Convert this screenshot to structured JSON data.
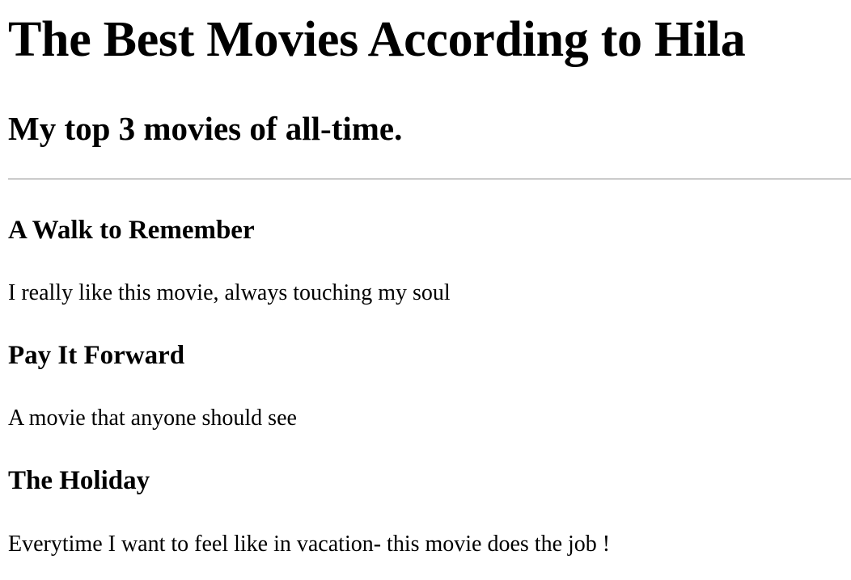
{
  "header": {
    "title": "The Best Movies According to Hila",
    "subtitle": "My top 3 movies of all-time."
  },
  "movies": [
    {
      "title": "A Walk to Remember",
      "description": "I really like this movie, always touching my soul"
    },
    {
      "title": "Pay It Forward",
      "description": "A movie that anyone should see"
    },
    {
      "title": "The Holiday",
      "description": "Everytime I want to feel like in vacation- this movie does the job !"
    }
  ]
}
